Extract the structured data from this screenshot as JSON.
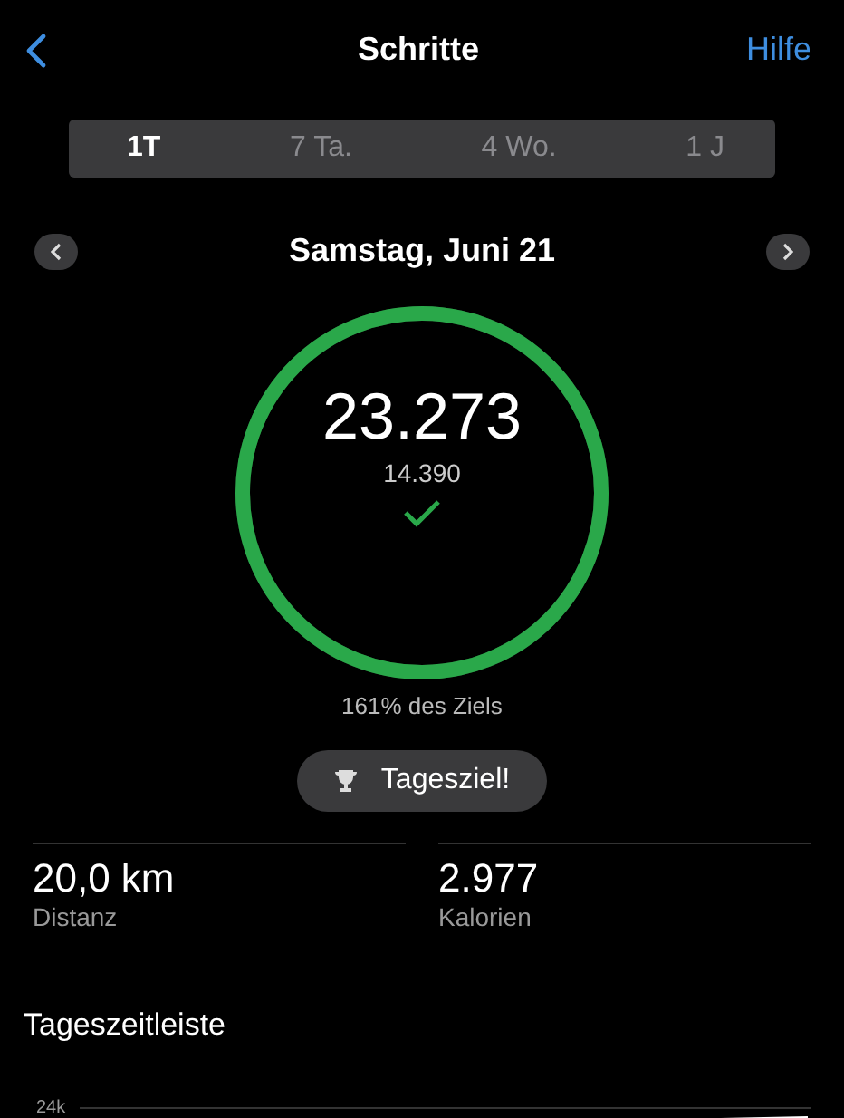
{
  "nav": {
    "title": "Schritte",
    "help": "Hilfe"
  },
  "tabs": [
    {
      "label": "1T",
      "selected": true
    },
    {
      "label": "7 Ta.",
      "selected": false
    },
    {
      "label": "4 Wo.",
      "selected": false
    },
    {
      "label": "1 J",
      "selected": false
    }
  ],
  "date": "Samstag, Juni 21",
  "ring": {
    "level": 1,
    "steps": "23.273",
    "goal": "14.390",
    "goal_reached": true
  },
  "goal_percent": "161% des Ziels",
  "badge": "Tagesziel!",
  "stats": [
    {
      "value": "20,0 km",
      "label": "Distanz"
    },
    {
      "value": "2.977",
      "label": "Kalorien"
    }
  ],
  "timeline": {
    "title": "Tageszeitleiste",
    "axis_label": "24k"
  }
}
